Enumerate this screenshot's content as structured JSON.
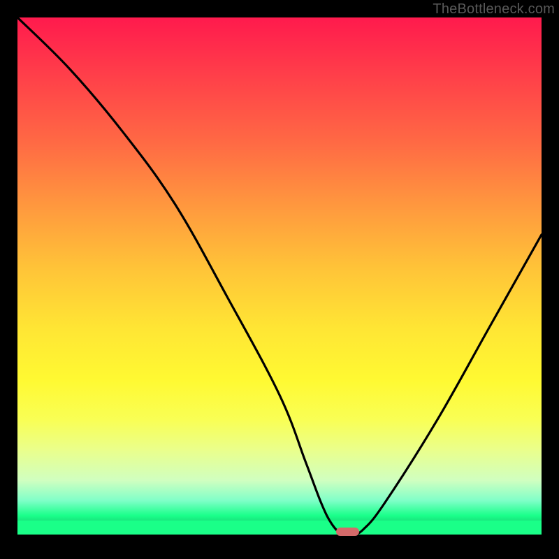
{
  "watermark": "TheBottleneck.com",
  "chart_data": {
    "type": "line",
    "title": "",
    "xlabel": "",
    "ylabel": "",
    "xlim": [
      0,
      100
    ],
    "ylim": [
      0,
      100
    ],
    "series": [
      {
        "name": "curve",
        "x": [
          0,
          10,
          20,
          30,
          40,
          50,
          55,
          58,
          60,
          62,
          64,
          66,
          70,
          80,
          90,
          100
        ],
        "y": [
          100,
          90,
          78,
          64,
          46,
          27,
          14,
          6,
          2,
          0,
          0,
          1,
          6,
          22,
          40,
          58
        ]
      }
    ],
    "marker": {
      "x": 63,
      "width_pct": 4.5
    },
    "colors": {
      "top": "#ff1a4d",
      "mid": "#fff932",
      "bottom": "#1aff88",
      "line": "#000000",
      "marker": "#d46a6a"
    }
  }
}
